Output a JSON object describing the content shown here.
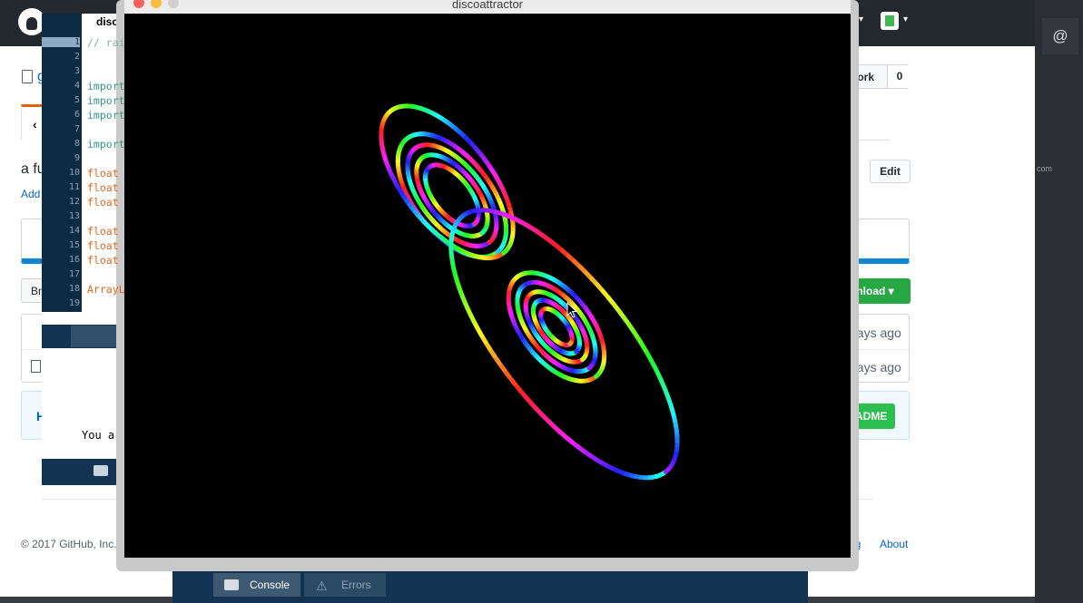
{
  "github": {
    "repo_link": "g",
    "fork_label": "Fork",
    "fork_count": "0",
    "tab_code_icon": "‹",
    "description": "a fu",
    "add_topics": "Add",
    "edit_label": "Edit",
    "branch_label": "Br",
    "download_label": "wnload ▾",
    "file_rows": [
      {
        "age": "days ago"
      },
      {
        "age": "days ago"
      }
    ],
    "readme_heading": "H",
    "readme_button": "EADME",
    "footer_copyright": "© 2017 GitHub, Inc.",
    "footer_blog": "og",
    "footer_about": "About",
    "right_at_symbol": "@",
    "right_domain": "com"
  },
  "editor": {
    "tab_label": "disco",
    "line_numbers": [
      "1",
      "2",
      "3",
      "4",
      "5",
      "6",
      "7",
      "8",
      "9",
      "10",
      "11",
      "12",
      "13",
      "14",
      "15",
      "16",
      "17",
      "18",
      "19"
    ],
    "code_lines": [
      {
        "line": 1,
        "text": "// rai",
        "kind": "comment"
      },
      {
        "line": 4,
        "text": "import",
        "kind": "import"
      },
      {
        "line": 5,
        "text": "import",
        "kind": "import"
      },
      {
        "line": 6,
        "text": "import",
        "kind": "import"
      },
      {
        "line": 8,
        "text": "import",
        "kind": "import"
      },
      {
        "line": 10,
        "text": "float",
        "kind": "float"
      },
      {
        "line": 11,
        "text": "float",
        "kind": "float"
      },
      {
        "line": 12,
        "text": "float",
        "kind": "float"
      },
      {
        "line": 14,
        "text": "float",
        "kind": "float"
      },
      {
        "line": 15,
        "text": "float",
        "kind": "float"
      },
      {
        "line": 16,
        "text": "float",
        "kind": "float"
      },
      {
        "line": 18,
        "text": "ArrayL",
        "kind": "float"
      }
    ],
    "console_text": "You are",
    "console_tab": "C"
  },
  "sketch": {
    "title": "discoattractor"
  },
  "bottom_console": {
    "console_label": "Console",
    "errors_label": "Errors"
  },
  "colors": {
    "github_header": "#24292e",
    "link": "#0366d6",
    "green_button": "#28a745",
    "editor_navy": "#123452"
  }
}
